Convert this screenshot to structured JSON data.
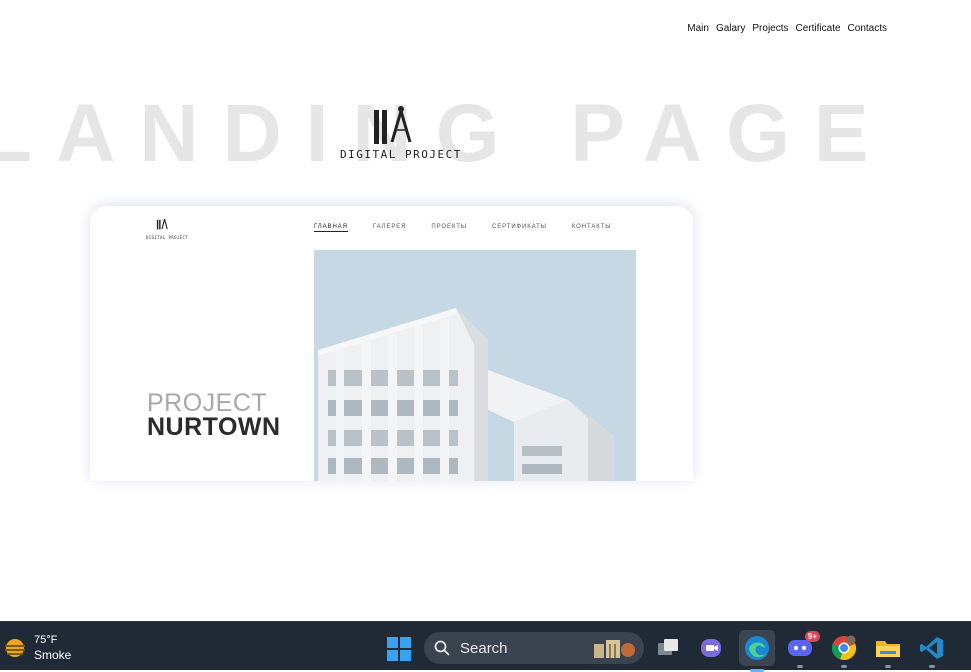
{
  "nav": {
    "items": [
      "Main",
      "Galary",
      "Projects",
      "Certificate",
      "Contacts"
    ]
  },
  "hero": {
    "background_title": "LANDING PAGE",
    "logo_text": "DIGITAL PROJECT"
  },
  "mockup": {
    "logo_text": "DIGITAL PROJECT",
    "nav": [
      "ГЛАВНАЯ",
      "ГАЛЕРЕЯ",
      "ПРОЕКТЫ",
      "СЕРТИФИКАТЫ",
      "КОНТАКТЫ"
    ],
    "title_light": "PROJECT",
    "title_bold": "NURTOWN"
  },
  "taskbar": {
    "weather": {
      "temp": "75°F",
      "condition": "Smoke"
    },
    "search_label": "Search",
    "discord_badge": "9+",
    "icons": [
      "windows-start",
      "search",
      "task-view",
      "teams-chat",
      "edge",
      "discord",
      "chrome",
      "file-explorer",
      "vscode"
    ]
  },
  "colors": {
    "taskbar_bg": "#202a36",
    "bg_title": "#e6e6e6",
    "accent": "#5fb6ff"
  }
}
